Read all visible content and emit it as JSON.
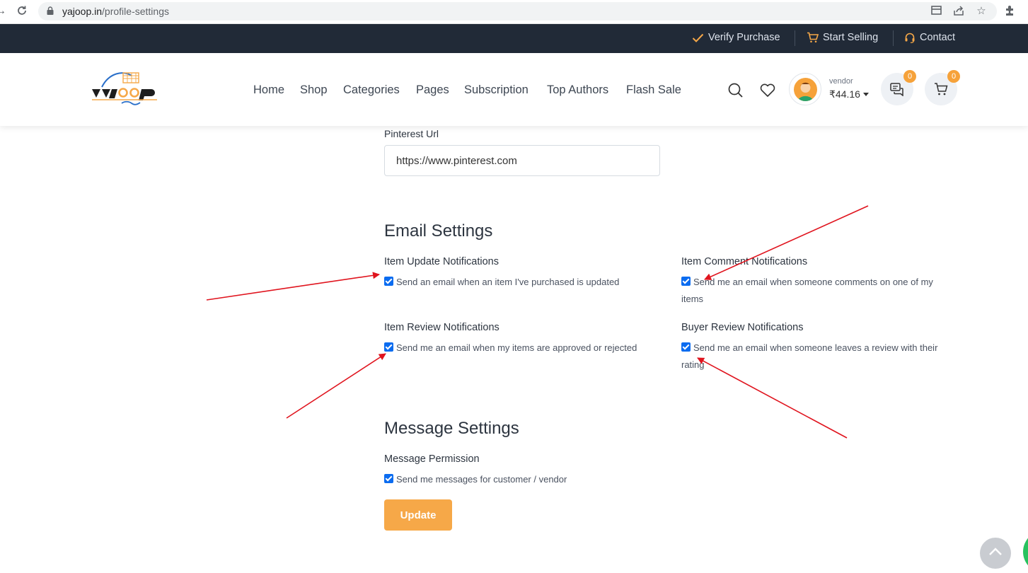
{
  "browser": {
    "url_host": "yajoop.in",
    "url_path": "/profile-settings"
  },
  "topbar": {
    "verify": "Verify Purchase",
    "start_selling": "Start Selling",
    "contact": "Contact"
  },
  "nav": {
    "items": [
      "Home",
      "Shop",
      "Categories",
      "Pages",
      "Subscription",
      "Top Authors",
      "Flash Sale"
    ]
  },
  "account": {
    "role": "vendor",
    "balance": "₹44.16",
    "messages_count": "0",
    "cart_count": "0"
  },
  "form": {
    "pinterest_label": "Pinterest Url",
    "pinterest_value": "https://www.pinterest.com",
    "email_section_title": "Email Settings",
    "item_update_label": "Item Update Notifications",
    "item_update_text": "Send an email when an item I've purchased is updated",
    "item_comment_label": "Item Comment Notifications",
    "item_comment_text_line1": "Send me an email when someone comments on one of my",
    "item_comment_text_line2": "items",
    "item_review_label": "Item Review Notifications",
    "item_review_text": "Send me an email when my items are approved or rejected",
    "buyer_review_label": "Buyer Review Notifications",
    "buyer_review_text_line1": "Send me an email when someone leaves a review with their",
    "buyer_review_text_line2": "rating",
    "message_section_title": "Message Settings",
    "message_permission_label": "Message Permission",
    "message_permission_text": "Send me messages for customer / vendor",
    "update_button": "Update"
  },
  "colors": {
    "accent": "#f6a848",
    "topbar_bg": "#212a37",
    "checkbox": "#0b6cf0",
    "annotation_arrow": "#e0141e"
  }
}
